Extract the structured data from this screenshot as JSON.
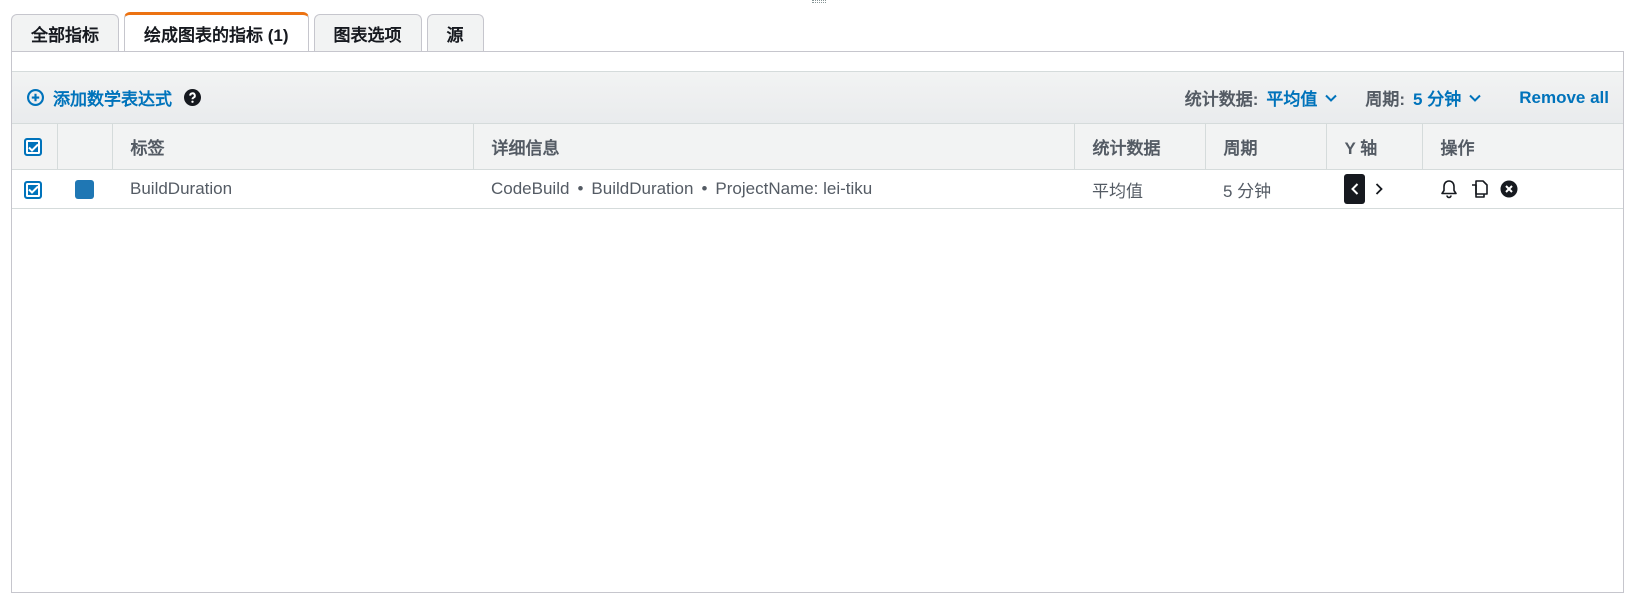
{
  "tabs": [
    {
      "label": "全部指标",
      "active": false
    },
    {
      "label": "绘成图表的指标 (1)",
      "active": true
    },
    {
      "label": "图表选项",
      "active": false
    },
    {
      "label": "源",
      "active": false
    }
  ],
  "toolbar": {
    "add_expression": "添加数学表达式",
    "statistic_label": "统计数据:",
    "statistic_value": "平均值",
    "period_label": "周期:",
    "period_value": "5 分钟",
    "remove_all": "Remove all"
  },
  "table": {
    "headers": {
      "label": "标签",
      "details": "详细信息",
      "statistic": "统计数据",
      "period": "周期",
      "y_axis": "Y 轴",
      "actions": "操作"
    },
    "rows": [
      {
        "checked": true,
        "color": "#1f77b4",
        "label": "BuildDuration",
        "details": {
          "namespace": "CodeBuild",
          "metric": "BuildDuration",
          "dimension": "ProjectName: lei-tiku"
        },
        "statistic": "平均值",
        "period": "5 分钟"
      }
    ]
  },
  "colors": {
    "accent": "#0073bb",
    "active_tab": "#ec7211"
  }
}
